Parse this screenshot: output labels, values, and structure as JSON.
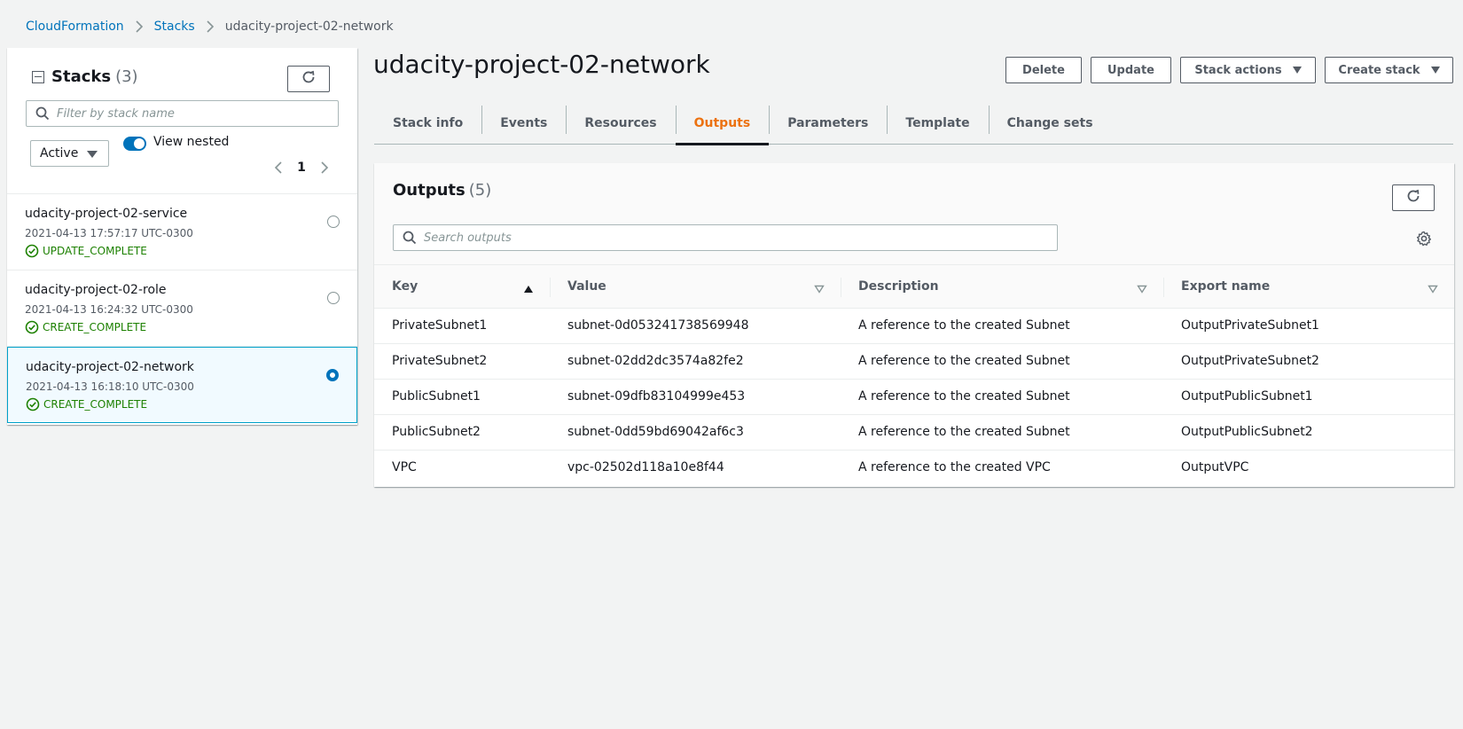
{
  "breadcrumb": {
    "items": [
      "CloudFormation",
      "Stacks"
    ],
    "current": "udacity-project-02-network"
  },
  "stacks_panel": {
    "title": "Stacks",
    "count": "(3)",
    "search_placeholder": "Filter by stack name",
    "status_filter": "Active",
    "view_nested_label": "View nested",
    "page": "1",
    "items": [
      {
        "name": "udacity-project-02-service",
        "time": "2021-04-13 17:57:17 UTC-0300",
        "status": "UPDATE_COMPLETE",
        "selected": false
      },
      {
        "name": "udacity-project-02-role",
        "time": "2021-04-13 16:24:32 UTC-0300",
        "status": "CREATE_COMPLETE",
        "selected": false
      },
      {
        "name": "udacity-project-02-network",
        "time": "2021-04-13 16:18:10 UTC-0300",
        "status": "CREATE_COMPLETE",
        "selected": true
      }
    ]
  },
  "main": {
    "title": "udacity-project-02-network",
    "buttons": {
      "delete": "Delete",
      "update": "Update",
      "stack_actions": "Stack actions",
      "create_stack": "Create stack"
    },
    "tabs": [
      {
        "label": "Stack info",
        "active": false
      },
      {
        "label": "Events",
        "active": false
      },
      {
        "label": "Resources",
        "active": false
      },
      {
        "label": "Outputs",
        "active": true
      },
      {
        "label": "Parameters",
        "active": false
      },
      {
        "label": "Template",
        "active": false
      },
      {
        "label": "Change sets",
        "active": false
      }
    ]
  },
  "outputs": {
    "title": "Outputs",
    "count": "(5)",
    "search_placeholder": "Search outputs",
    "columns": [
      "Key",
      "Value",
      "Description",
      "Export name"
    ],
    "rows": [
      [
        "PrivateSubnet1",
        "subnet-0d053241738569948",
        "A reference to the created Subnet",
        "OutputPrivateSubnet1"
      ],
      [
        "PrivateSubnet2",
        "subnet-02dd2dc3574a82fe2",
        "A reference to the created Subnet",
        "OutputPrivateSubnet2"
      ],
      [
        "PublicSubnet1",
        "subnet-09dfb83104999e453",
        "A reference to the created Subnet",
        "OutputPublicSubnet1"
      ],
      [
        "PublicSubnet2",
        "subnet-0dd59bd69042af6c3",
        "A reference to the created Subnet",
        "OutputPublicSubnet2"
      ],
      [
        "VPC",
        "vpc-02502d118a10e8f44",
        "A reference to the created VPC",
        "OutputVPC"
      ]
    ]
  },
  "colors": {
    "link": "#0073bb",
    "active_tab": "#ec7211",
    "success": "#1d8102",
    "selected_border": "#00a1c9"
  }
}
